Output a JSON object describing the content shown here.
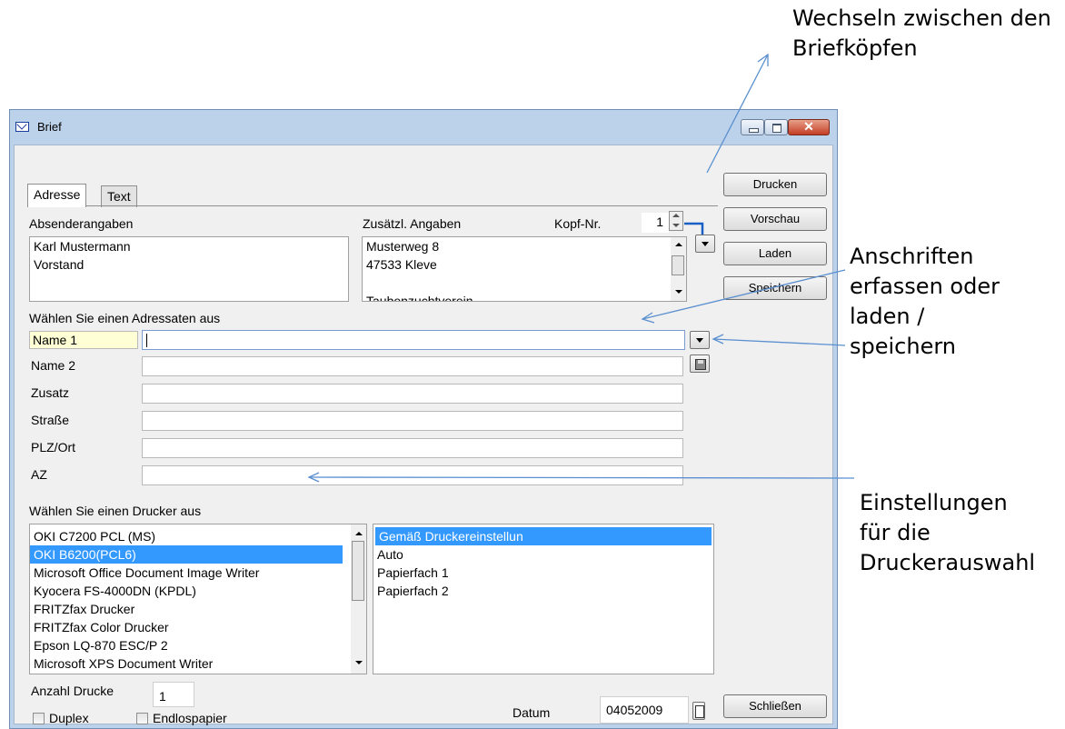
{
  "annotations": {
    "kopf": [
      "Wechseln zwischen den",
      "Briefköpfen"
    ],
    "anschriften": [
      "Anschriften",
      "erfassen oder",
      "laden /",
      "speichern"
    ],
    "drucker": [
      "Einstellungen",
      "für die",
      "Druckerauswahl"
    ]
  },
  "window": {
    "title": "Brief"
  },
  "tabs": [
    "Adresse",
    "Text"
  ],
  "sender": {
    "label": "Absenderangaben",
    "lines": [
      "Karl Mustermann",
      "Vorstand"
    ]
  },
  "extra": {
    "label": "Zusätzl. Angaben",
    "lines": [
      "Musterweg 8",
      "47533 Kleve",
      "",
      "Taubenzuchtverein"
    ]
  },
  "kopf_nr": {
    "label": "Kopf-Nr.",
    "value": "1"
  },
  "recipient": {
    "label": "Wählen Sie einen Adressaten aus",
    "fields": [
      {
        "label": "Name 1",
        "value": ""
      },
      {
        "label": "Name 2",
        "value": ""
      },
      {
        "label": "Zusatz",
        "value": ""
      },
      {
        "label": "Straße",
        "value": ""
      },
      {
        "label": "PLZ/Ort",
        "value": ""
      },
      {
        "label": "AZ",
        "value": ""
      }
    ]
  },
  "printer": {
    "label": "Wählen Sie einen Drucker aus",
    "printers": [
      "OKI C7200 PCL (MS)",
      "OKI B6200(PCL6)",
      "Microsoft Office Document Image Writer",
      "Kyocera FS-4000DN (KPDL)",
      "FRITZfax Drucker",
      "FRITZfax Color Drucker",
      "Epson LQ-870 ESC/P 2",
      "Microsoft XPS Document Writer"
    ],
    "selected_printer": 1,
    "trays": [
      "Gemäß Druckereinstellun",
      "Auto",
      "Papierfach 1",
      "Papierfach 2"
    ],
    "selected_tray": 0
  },
  "copies": {
    "label": "Anzahl Drucke",
    "value": "1"
  },
  "options": {
    "duplex": "Duplex",
    "continuous": "Endlospapier"
  },
  "date": {
    "label": "Datum",
    "value": "04052009"
  },
  "buttons": {
    "print": "Drucken",
    "preview": "Vorschau",
    "load": "Laden",
    "save": "Speichern",
    "close": "Schließen"
  }
}
